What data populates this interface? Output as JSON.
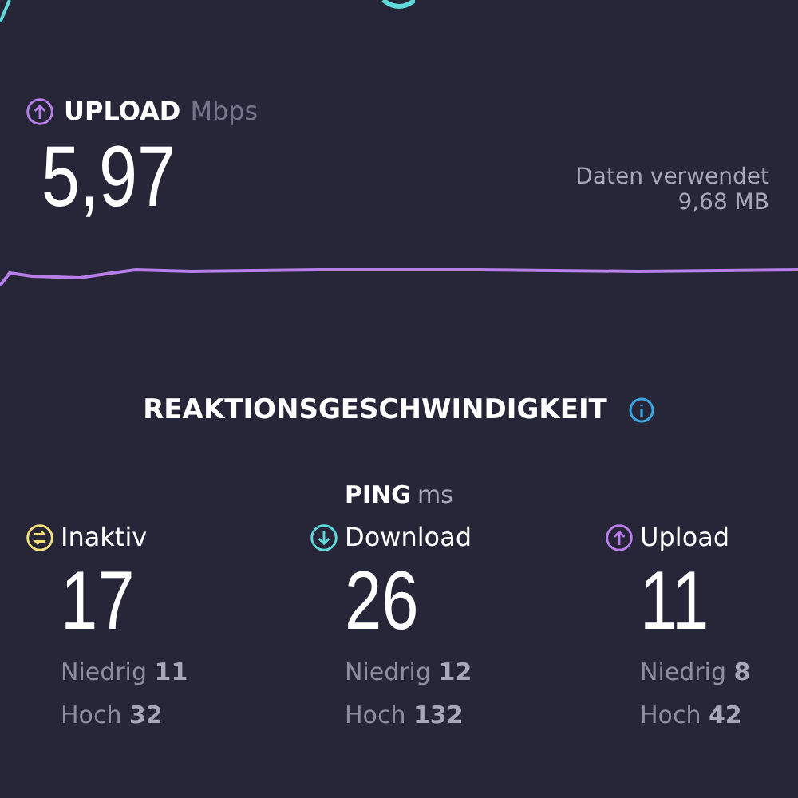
{
  "upload": {
    "label": "UPLOAD",
    "unit": "Mbps",
    "value": "5,97",
    "data_label": "Daten verwendet",
    "data_value": "9,68 MB"
  },
  "latency": {
    "title": "REAKTIONSGESCHWINDIGKEIT",
    "ping_label": "PING",
    "ping_unit": "ms",
    "columns": [
      {
        "kind": "idle",
        "color": "#f3e07a",
        "label": "Inaktiv",
        "value": "17",
        "low": "Niedrig **11**",
        "high": "Hoch **32**"
      },
      {
        "kind": "download",
        "color": "#5fd9d9",
        "label": "Download",
        "value": "26",
        "low": "Niedrig **12**",
        "high": "Hoch **132**"
      },
      {
        "kind": "upload",
        "color": "#b77ee8",
        "label": "Upload",
        "value": "11",
        "low": "Niedrig **8**",
        "high": "Hoch **42**"
      }
    ]
  }
}
